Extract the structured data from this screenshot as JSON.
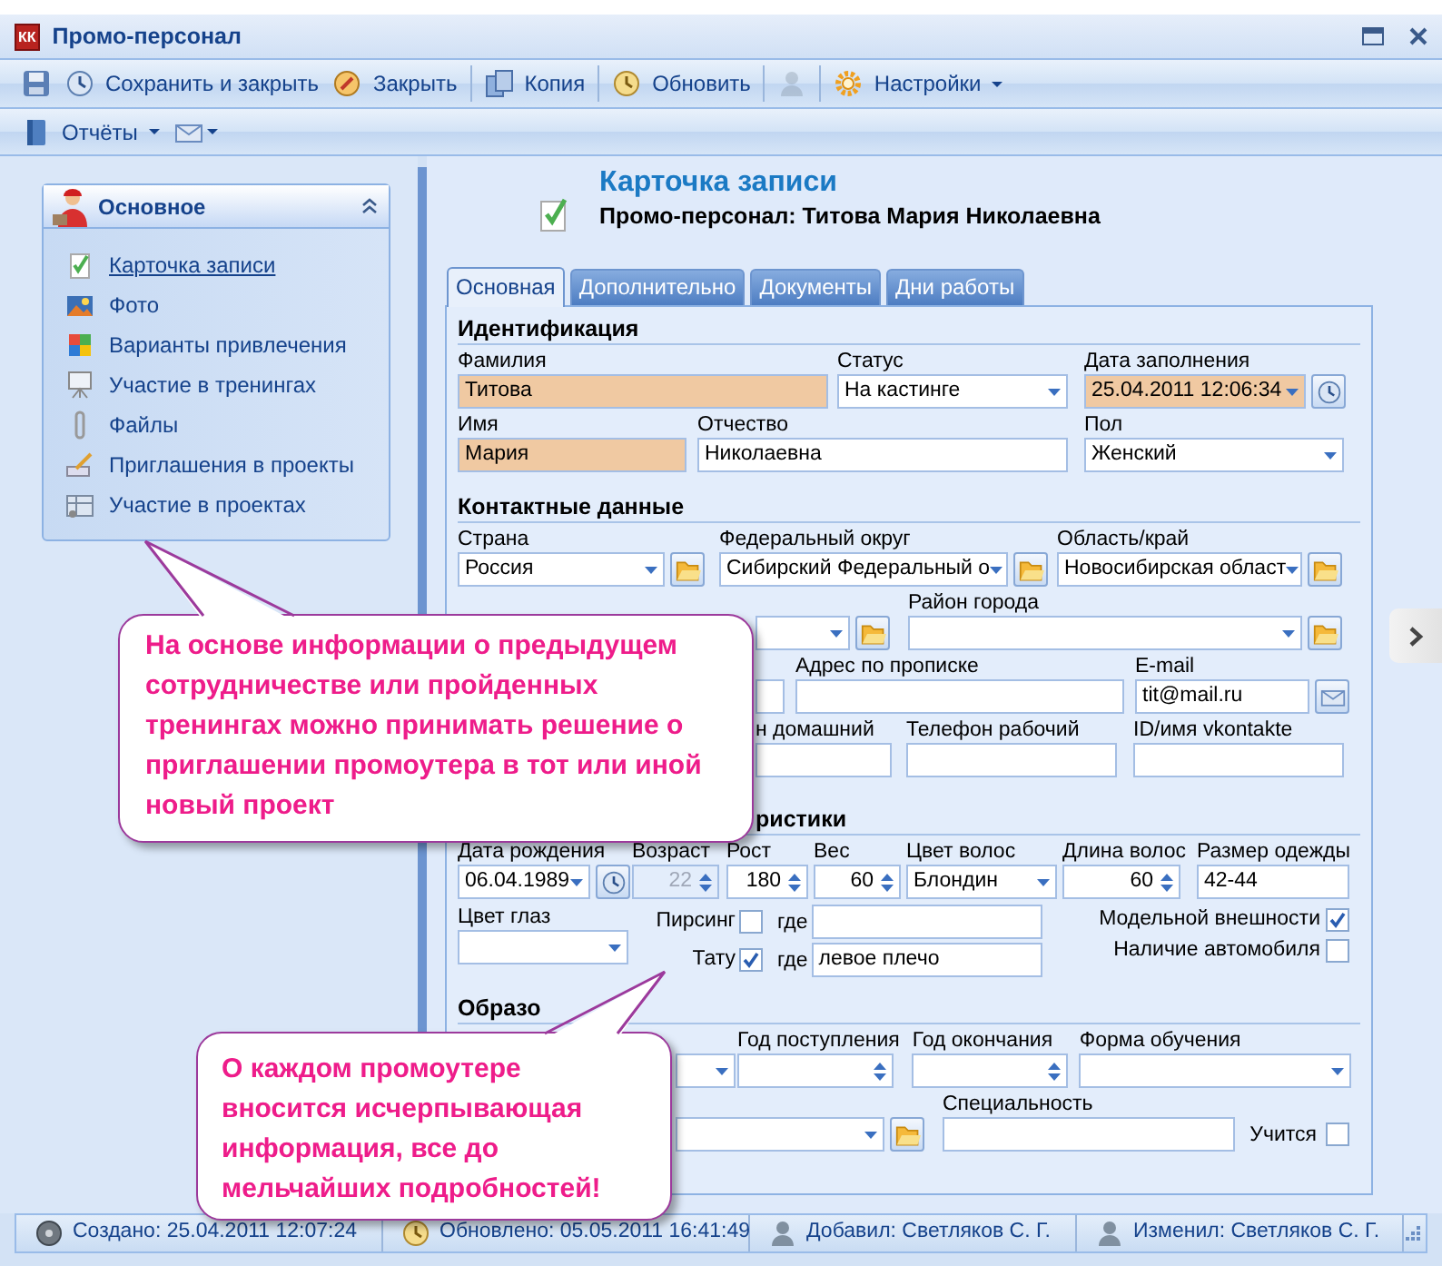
{
  "window": {
    "title": "Промо-персонал",
    "logo": "КК"
  },
  "toolbar": [
    {
      "kind": "icon",
      "disabled": false
    },
    {
      "kind": "button",
      "label": "Сохранить и закрыть"
    },
    {
      "kind": "button",
      "label": "Закрыть"
    },
    {
      "kind": "separator"
    },
    {
      "kind": "button",
      "label": "Копия"
    },
    {
      "kind": "separator"
    },
    {
      "kind": "button",
      "label": "Обновить"
    },
    {
      "kind": "separator"
    },
    {
      "kind": "icon",
      "disabled": true
    },
    {
      "kind": "separator"
    },
    {
      "kind": "menu",
      "label": "Настройки"
    }
  ],
  "toolbar2": [
    {
      "kind": "menu",
      "label": "Отчёты"
    },
    {
      "kind": "icon-menu"
    }
  ],
  "sidebar": {
    "title": "Основное",
    "expanded": true,
    "items": [
      {
        "label": "Карточка записи",
        "selected": true
      },
      {
        "label": "Фото",
        "selected": false
      },
      {
        "label": "Варианты привлечения",
        "selected": false
      },
      {
        "label": "Участие в тренингах",
        "selected": false
      },
      {
        "label": "Файлы",
        "selected": false
      },
      {
        "label": "Приглашения в проекты",
        "selected": false
      },
      {
        "label": "Участие в проектах",
        "selected": false
      }
    ]
  },
  "header": {
    "title": "Карточка записи",
    "subtitle": "Промо-персонал: Титова Мария Николаевна"
  },
  "tabs": [
    {
      "label": "Основная",
      "selected": true
    },
    {
      "label": "Дополнительно",
      "selected": false
    },
    {
      "label": "Документы",
      "selected": false
    },
    {
      "label": "Дни работы",
      "selected": false
    }
  ],
  "sections": [
    {
      "title": "Идентификация",
      "rows": [
        [
          {
            "label": "Фамилия",
            "kind": "text",
            "value": "Титова",
            "required": true
          },
          {
            "label": "Статус",
            "kind": "combo",
            "value": "На кастинге",
            "required": false
          },
          {
            "label": "Дата заполнения",
            "kind": "combo",
            "value": "25.04.2011 12:06:34",
            "required": true,
            "button": {
              "kind": "now"
            }
          }
        ],
        [
          {
            "label": "Имя",
            "kind": "text",
            "value": "Мария",
            "required": true
          },
          {
            "label": "Отчество",
            "kind": "text",
            "value": "Николаевна",
            "required": false
          },
          {
            "label": "Пол",
            "kind": "combo",
            "value": "Женский",
            "required": false
          }
        ]
      ]
    },
    {
      "title": "Контактные данные",
      "rows": [
        [
          {
            "label": "Страна",
            "kind": "combo",
            "value": "Россия",
            "button": {
              "kind": "lookup"
            }
          },
          {
            "label": "Федеральный округ",
            "kind": "combo",
            "value": "Сибирский Федеральный о",
            "button": {
              "kind": "lookup"
            }
          },
          {
            "label": "Область/край",
            "kind": "combo",
            "value": "Новосибирская област",
            "button": {
              "kind": "lookup"
            }
          }
        ],
        [
          {
            "kind": "combo",
            "button": {
              "kind": "lookup"
            }
          },
          {
            "label": "Район города",
            "kind": "combo",
            "button": {
              "kind": "lookup"
            }
          }
        ],
        [
          {
            "kind": "text"
          },
          {
            "label": "Адрес по прописке",
            "kind": "text"
          },
          {
            "label": "E-mail",
            "kind": "text",
            "value": "tit@mail.ru",
            "button": {
              "kind": "email"
            }
          }
        ],
        [
          "",
          {
            "label": "н домашний",
            "kind": "text"
          },
          {
            "label": "Телефон рабочий",
            "kind": "text"
          },
          {
            "label": "ID/имя vkontakte",
            "kind": "text"
          }
        ]
      ]
    },
    {
      "title": "ристики",
      "rows": [
        [
          {
            "label": "Дата рождения",
            "kind": "combo",
            "value": "06.04.1989",
            "button": {
              "kind": "now"
            }
          },
          {
            "label": "Возраст",
            "kind": "spin",
            "value": "22",
            "disabled": true
          },
          {
            "label": "Рост",
            "kind": "spin",
            "value": "180",
            "disabled": false
          },
          {
            "label": "Вес",
            "kind": "spin",
            "value": "60",
            "disabled": false
          },
          {
            "label": "Цвет волос",
            "kind": "combo",
            "value": "Блондин"
          },
          {
            "label": "Длина волос",
            "kind": "spin",
            "value": "60",
            "disabled": false
          },
          {
            "label": "Размер одежды",
            "kind": "text",
            "value": "42-44"
          }
        ]
      ],
      "eye_color": {
        "label": "Цвет глаз",
        "kind": "combo"
      },
      "marks": [
        {
          "label": "Пирсинг",
          "checked": false,
          "where_label": "где"
        },
        {
          "label": "Тату",
          "checked": true,
          "where_label": "где",
          "where_value": "левое плечо"
        }
      ],
      "flags": [
        {
          "label": "Модельной внешности",
          "checked": true
        },
        {
          "label": "Наличие автомобиля",
          "checked": false
        }
      ]
    },
    {
      "title": "Образо",
      "rows": [
        [
          {
            "kind": "combo"
          },
          {
            "label": "Год поступления",
            "kind": "spin",
            "disabled": false
          },
          {
            "label": "Год окончания",
            "kind": "spin",
            "disabled": false
          },
          {
            "label": "Форма обучения",
            "kind": "combo"
          }
        ],
        [
          {
            "kind": "combo",
            "button": {
              "kind": "lookup"
            }
          },
          "",
          {
            "label": "Специальность",
            "kind": "text"
          },
          {
            "label": "Учится",
            "kind": "checkbox",
            "checked": false
          }
        ]
      ]
    }
  ],
  "callouts": [
    {
      "text": "На основе информации о предыдущем сотрудничестве или пройденных тренингах можно принимать решение о приглашении промоутера в тот или иной новый проект"
    },
    {
      "text": "О каждом промоутере вносится исчерпывающая информация, все до мельчайших подробностей!"
    }
  ],
  "status_bar": [
    {
      "text": "Создано: 25.04.2011 12:07:24"
    },
    {
      "text": "Обновлено: 05.05.2011 16:41:49"
    },
    {
      "text": "Добавил: Светляков С. Г."
    },
    {
      "text": "Изменил: Светляков С. Г."
    }
  ]
}
